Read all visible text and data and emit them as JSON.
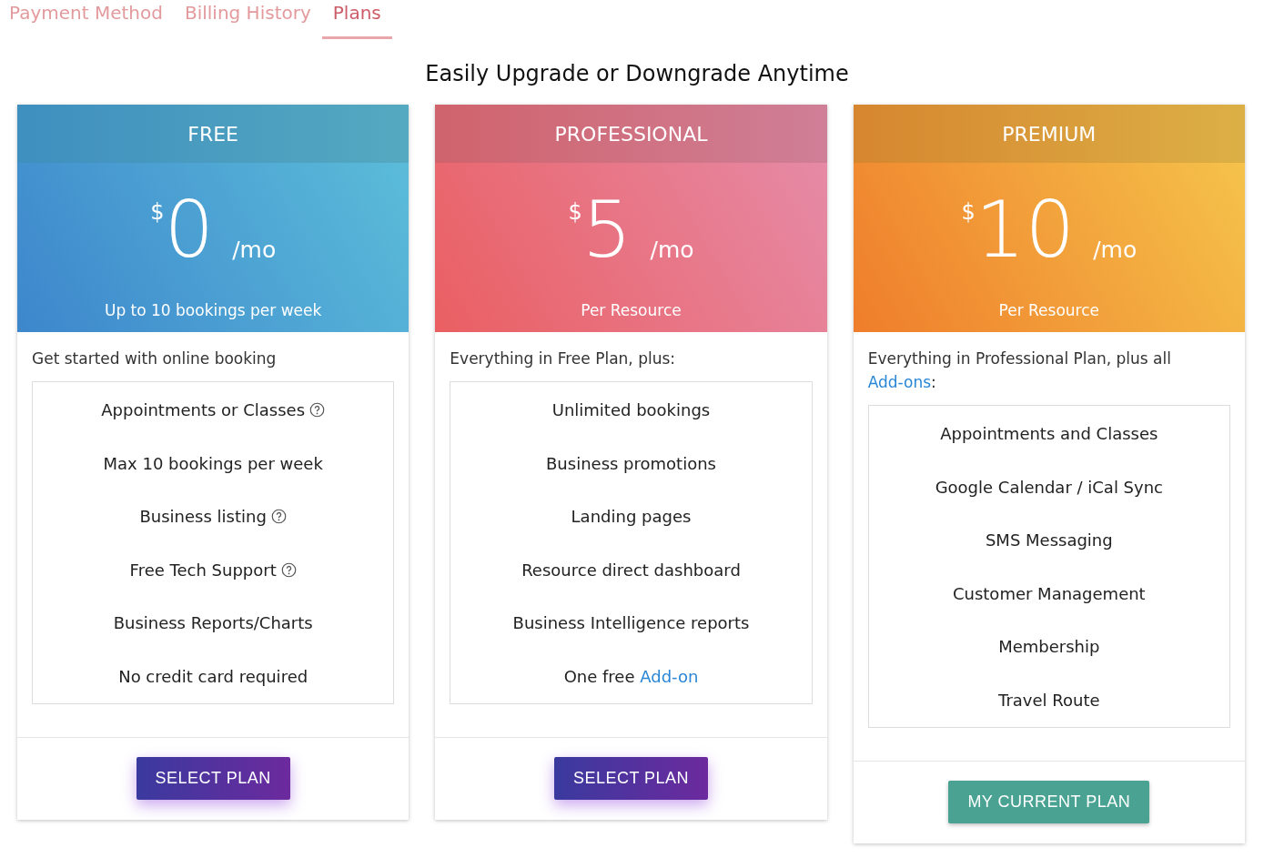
{
  "tabs": [
    {
      "label": "Payment Method",
      "selected": false
    },
    {
      "label": "Billing History",
      "selected": false
    },
    {
      "label": "Plans",
      "selected": true
    }
  ],
  "heading": "Easily Upgrade or Downgrade Anytime",
  "plans": [
    {
      "kind": "free",
      "name": "FREE",
      "currency": "$",
      "amount": "0",
      "period": "/mo",
      "note": "Up to 10 bookings per week",
      "intro": {
        "text": "Get started with online booking"
      },
      "features": [
        {
          "text": "Appointments or Classes",
          "help": true
        },
        {
          "text": "Max 10 bookings per week",
          "help": false
        },
        {
          "text": "Business listing",
          "help": true
        },
        {
          "text": "Free Tech Support",
          "help": true
        },
        {
          "text": "Business Reports/Charts",
          "help": false
        },
        {
          "text": "No credit card required",
          "help": false
        }
      ],
      "button": {
        "kind": "select",
        "label": "SELECT PLAN"
      }
    },
    {
      "kind": "professional",
      "name": "PROFESSIONAL",
      "currency": "$",
      "amount": "5",
      "period": "/mo",
      "note": "Per Resource",
      "intro": {
        "text": "Everything in Free Plan, plus:"
      },
      "features": [
        {
          "text": "Unlimited bookings",
          "help": false
        },
        {
          "text": "Business promotions",
          "help": false
        },
        {
          "text": "Landing pages",
          "help": false
        },
        {
          "text": "Resource direct dashboard",
          "help": false
        },
        {
          "text": "Business Intelligence reports",
          "help": false
        },
        {
          "text": "One free ",
          "link": "Add-on",
          "help": false
        }
      ],
      "button": {
        "kind": "select",
        "label": "SELECT PLAN"
      }
    },
    {
      "kind": "premium",
      "name": "PREMIUM",
      "currency": "$",
      "amount": "10",
      "period": "/mo",
      "note": "Per Resource",
      "intro": {
        "text": "Everything in Professional Plan, plus all ",
        "link": "Add-ons",
        "after": ":"
      },
      "features": [
        {
          "text": "Appointments and Classes",
          "help": false
        },
        {
          "text": "Google Calendar / iCal Sync",
          "help": false
        },
        {
          "text": "SMS Messaging",
          "help": false
        },
        {
          "text": "Customer Management",
          "help": false
        },
        {
          "text": "Membership",
          "help": false
        },
        {
          "text": "Travel Route",
          "help": false
        }
      ],
      "button": {
        "kind": "current",
        "label": "MY CURRENT PLAN"
      }
    }
  ]
}
